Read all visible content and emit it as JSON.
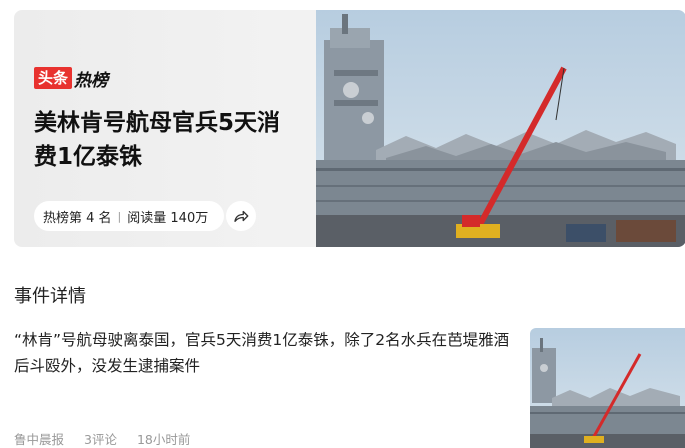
{
  "hero": {
    "brand_badge": "头条",
    "brand_text": "热榜",
    "title": "美林肯号航母官兵5天消费1亿泰铢",
    "rank": "热榜第 4 名",
    "reads": "阅读量 140万",
    "share_icon": "share-icon"
  },
  "section": {
    "title": "事件详情"
  },
  "article": {
    "text": "“林肯”号航母驶离泰国，官兵5天消费1亿泰铢，除了2名水兵在芭堤雅酒后斗殴外，没发生逮捕案件",
    "source": "鲁中晨报",
    "comments": "3评论",
    "time": "18小时前"
  },
  "colors": {
    "brand_red": "#e8322f",
    "crane_red": "#d42a2a",
    "sky": "#a9c3d8"
  }
}
